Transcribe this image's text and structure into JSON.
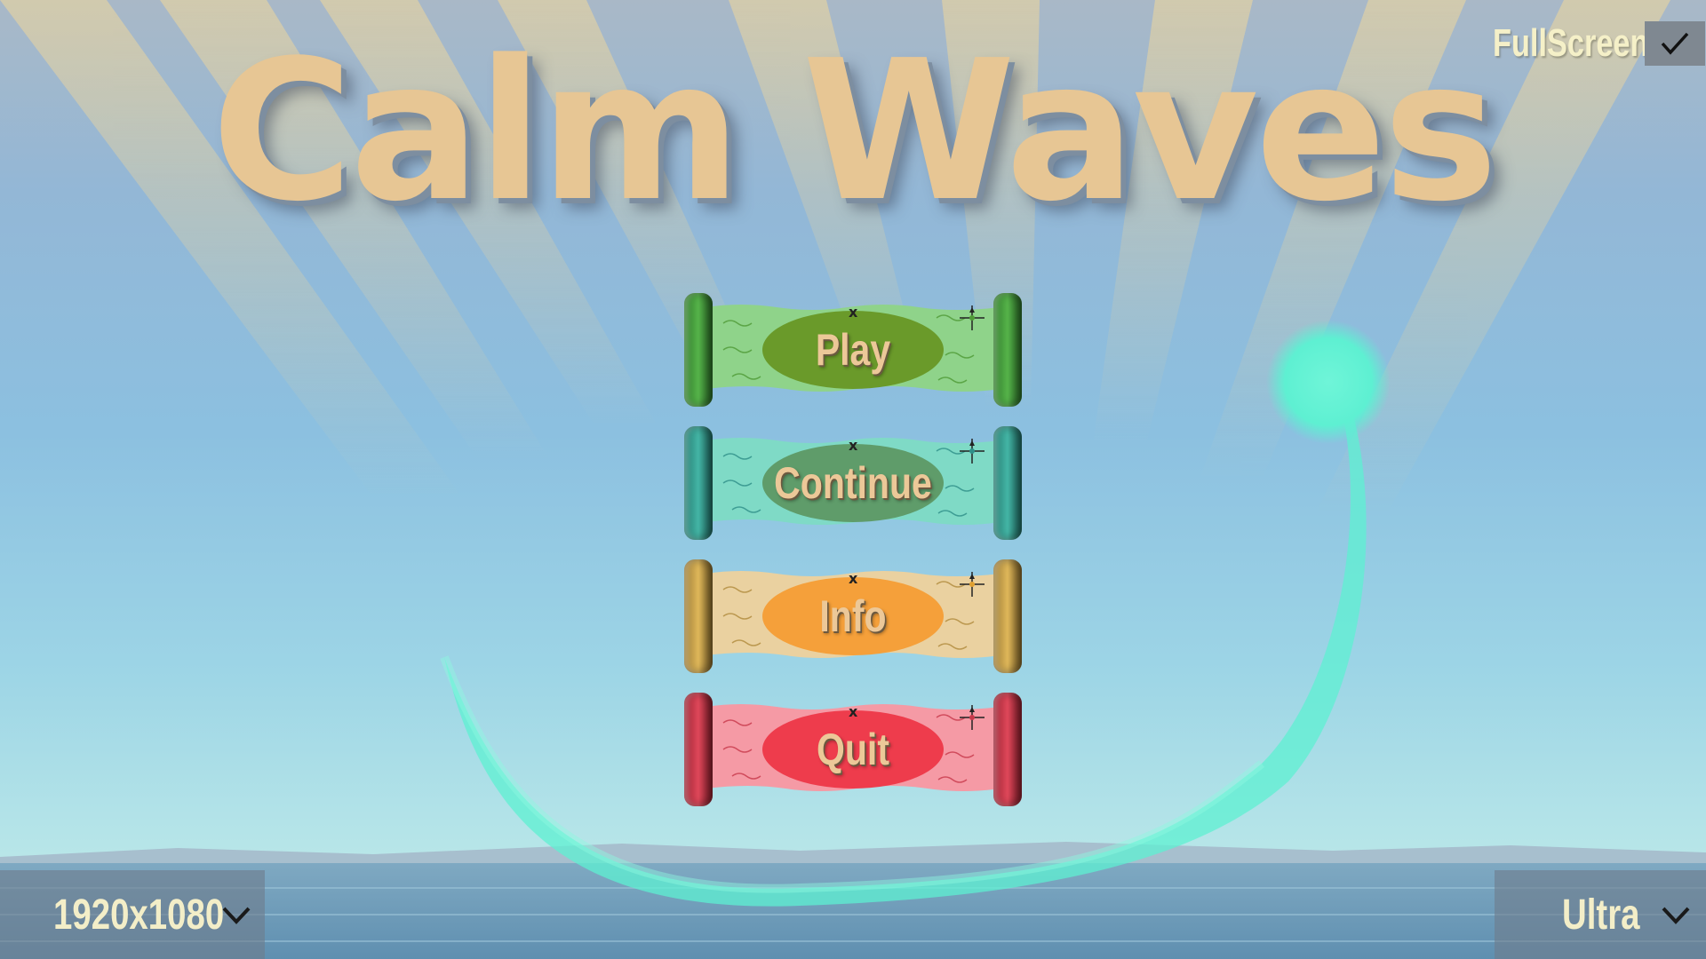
{
  "game": {
    "title": "Calm Waves"
  },
  "menu": {
    "buttons": [
      {
        "label": "Play",
        "color": "#4f9a36",
        "paper": "#8fd38a",
        "oval": "#6a9a2a"
      },
      {
        "label": "Continue",
        "color": "#3aa596",
        "paper": "#7fdac6",
        "oval": "#5f9c6a"
      },
      {
        "label": "Info",
        "color": "#c6a04c",
        "paper": "#ead1a0",
        "oval": "#f5a03a"
      },
      {
        "label": "Quit",
        "color": "#c8384a",
        "paper": "#f59aa5",
        "oval": "#ee3c4c"
      }
    ],
    "map_marker": "x",
    "compass_icon": "compass-icon"
  },
  "settings": {
    "fullscreen_label": "FullScreen",
    "fullscreen_checked": true,
    "resolution": "1920x1080",
    "quality": "Ultra"
  },
  "colors": {
    "title_sand": "#e7c694",
    "wave_glow": "#5ff2d2"
  }
}
